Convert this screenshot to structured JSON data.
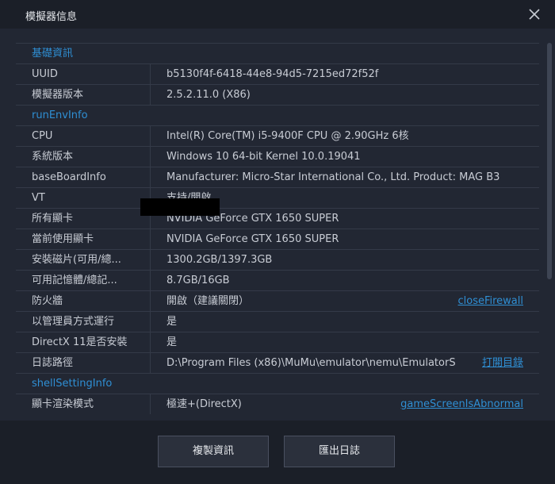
{
  "window": {
    "title": "模擬器信息"
  },
  "sections": [
    {
      "title": "基礎資訊",
      "rows": [
        {
          "key": "UUID",
          "value": "b5130f4f-6418-44e8-94d5-7215ed72f52f"
        },
        {
          "key": "模擬器版本",
          "value": "2.5.2.11.0 (X86)"
        }
      ]
    },
    {
      "title": "runEnvInfo",
      "rows": [
        {
          "key": "CPU",
          "value": "Intel(R) Core(TM) i5-9400F CPU @ 2.90GHz 6核"
        },
        {
          "key": "系統版本",
          "value": "Windows 10 64-bit Kernel 10.0.19041"
        },
        {
          "key": "baseBoardInfo",
          "value": "Manufacturer: Micro-Star International Co., Ltd.  Product: MAG B3"
        },
        {
          "key": "VT",
          "value": "支持/開啟"
        },
        {
          "key": "所有顯卡",
          "value": "NVIDIA GeForce GTX 1650 SUPER"
        },
        {
          "key": "當前使用顯卡",
          "value": "NVIDIA GeForce GTX 1650 SUPER"
        },
        {
          "key": "安裝磁片(可用/總...",
          "value": "1300.2GB/1397.3GB"
        },
        {
          "key": "可用記憶體/總記...",
          "value": "8.7GB/16GB"
        },
        {
          "key": "防火牆",
          "value": "開啟（建議關閉）",
          "action": "closeFirewall"
        },
        {
          "key": "以管理員方式運行",
          "value": "是"
        },
        {
          "key": "DirectX 11是否安裝",
          "value": "是"
        },
        {
          "key": "日誌路徑",
          "value": "D:\\Program Files (x86)\\MuMu\\emulator\\nemu\\EmulatorS",
          "action": "打開目錄"
        }
      ]
    },
    {
      "title": "shellSettingInfo",
      "rows": [
        {
          "key": "顯卡渲染模式",
          "value": "極速+(DirectX)",
          "action": "gameScreenIsAbnormal"
        }
      ]
    }
  ],
  "buttons": {
    "copy": "複製資訊",
    "export": "匯出日誌"
  },
  "colors": {
    "background": "#1b1f28",
    "panel": "#222733",
    "accent": "#2f8fd4",
    "text": "#c8ccd4"
  },
  "icons": {
    "close": "close-icon"
  }
}
